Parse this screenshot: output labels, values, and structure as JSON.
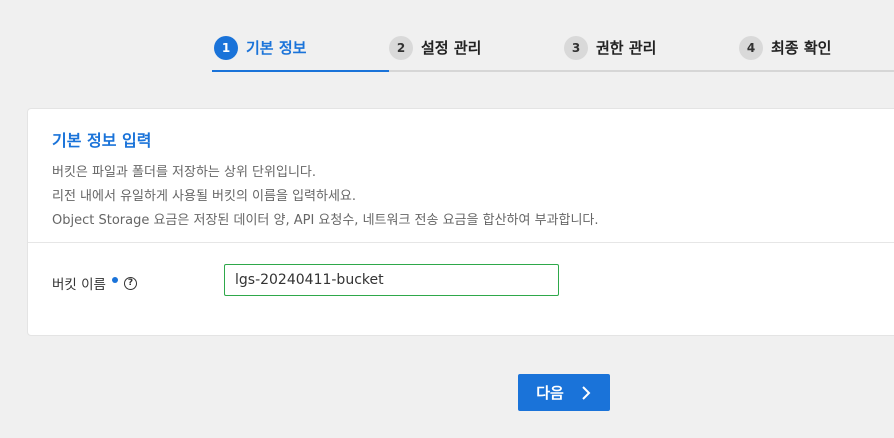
{
  "stepper": {
    "steps": [
      {
        "num": "1",
        "label": "기본 정보",
        "active": true
      },
      {
        "num": "2",
        "label": "설정 관리",
        "active": false
      },
      {
        "num": "3",
        "label": "권한 관리",
        "active": false
      },
      {
        "num": "4",
        "label": "최종 확인",
        "active": false
      }
    ]
  },
  "card": {
    "title": "기본 정보 입력",
    "desc": [
      "버킷은 파일과 폴더를 저장하는 상위 단위입니다.",
      "리전 내에서 유일하게 사용될 버킷의 이름을 입력하세요.",
      "Object Storage 요금은 저장된 데이터 양, API 요청수, 네트워크 전송 요금을 합산하여 부과합니다."
    ],
    "field": {
      "label": "버킷 이름",
      "help_glyph": "?",
      "value": "lgs-20240411-bucket"
    }
  },
  "footer": {
    "next_label": "다음"
  },
  "colors": {
    "accent": "#1a73d9",
    "input_border": "#2ea84a"
  },
  "icons": {
    "next": "chevron-right-icon",
    "help": "question-circle-icon"
  }
}
